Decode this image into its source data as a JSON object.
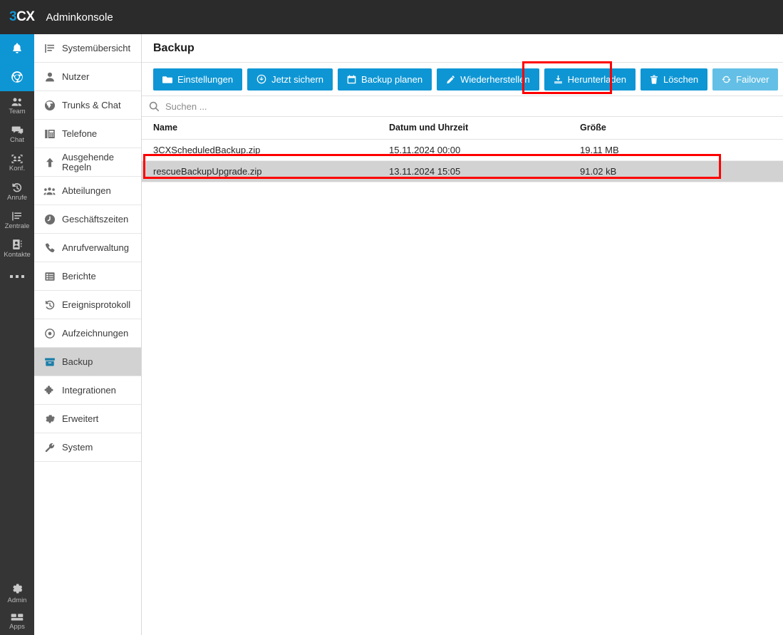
{
  "topbar": {
    "logo_3": "3",
    "logo_cx": "CX",
    "title": "Adminkonsole"
  },
  "rail": {
    "items": [
      {
        "label": "",
        "icon": "bell-icon",
        "state": "blue"
      },
      {
        "label": "",
        "icon": "browser-icon",
        "state": "blue"
      },
      {
        "label": "Team",
        "icon": "team-icon",
        "state": "normal"
      },
      {
        "label": "Chat",
        "icon": "chat-icon",
        "state": "normal"
      },
      {
        "label": "Konf.",
        "icon": "conference-icon",
        "state": "normal"
      },
      {
        "label": "Anrufe",
        "icon": "call-history-icon",
        "state": "normal"
      },
      {
        "label": "Zentrale",
        "icon": "switchboard-icon",
        "state": "normal"
      },
      {
        "label": "Kontakte",
        "icon": "contacts-icon",
        "state": "normal"
      },
      {
        "label": "",
        "icon": "more-dots-icon",
        "state": "normal"
      }
    ],
    "bottom_items": [
      {
        "label": "Admin",
        "icon": "gear-icon"
      },
      {
        "label": "Apps",
        "icon": "apps-grid-icon"
      }
    ]
  },
  "sidebar": {
    "items": [
      {
        "label": "Systemübersicht",
        "icon": "system-overview-icon",
        "active": false
      },
      {
        "label": "Nutzer",
        "icon": "user-icon",
        "active": false
      },
      {
        "label": "Trunks & Chat",
        "icon": "globe-icon",
        "active": false
      },
      {
        "label": "Telefone",
        "icon": "phone-device-icon",
        "active": false
      },
      {
        "label": "Ausgehende Regeln",
        "icon": "up-arrow-icon",
        "active": false
      },
      {
        "label": "Abteilungen",
        "icon": "departments-icon",
        "active": false
      },
      {
        "label": "Geschäftszeiten",
        "icon": "clock-icon",
        "active": false
      },
      {
        "label": "Anrufverwaltung",
        "icon": "handset-icon",
        "active": false
      },
      {
        "label": "Berichte",
        "icon": "reports-icon",
        "active": false
      },
      {
        "label": "Ereignisprotokoll",
        "icon": "event-log-icon",
        "active": false
      },
      {
        "label": "Aufzeichnungen",
        "icon": "record-icon",
        "active": false
      },
      {
        "label": "Backup",
        "icon": "backup-archive-icon",
        "active": true
      },
      {
        "label": "Integrationen",
        "icon": "puzzle-icon",
        "active": false
      },
      {
        "label": "Erweitert",
        "icon": "gear-icon",
        "active": false
      },
      {
        "label": "System",
        "icon": "wrench-icon",
        "active": false
      }
    ]
  },
  "page": {
    "title": "Backup"
  },
  "toolbar": {
    "buttons": [
      {
        "label": "Einstellungen",
        "icon": "folder-icon",
        "disabled": false,
        "highlighted": false
      },
      {
        "label": "Jetzt sichern",
        "icon": "backup-now-icon",
        "disabled": false,
        "highlighted": false
      },
      {
        "label": "Backup planen",
        "icon": "calendar-icon",
        "disabled": false,
        "highlighted": false
      },
      {
        "label": "Wiederherstellen",
        "icon": "pencil-icon",
        "disabled": false,
        "highlighted": false
      },
      {
        "label": "Herunterladen",
        "icon": "download-icon",
        "disabled": false,
        "highlighted": true
      },
      {
        "label": "Löschen",
        "icon": "trash-icon",
        "disabled": false,
        "highlighted": false
      },
      {
        "label": "Failover",
        "icon": "refresh-icon",
        "disabled": true,
        "highlighted": false
      }
    ]
  },
  "search": {
    "placeholder": "Suchen ...",
    "value": "",
    "icon": "search-icon"
  },
  "table": {
    "columns": [
      "Name",
      "Datum und Uhrzeit",
      "Größe"
    ],
    "rows": [
      {
        "name": "3CXScheduledBackup.zip",
        "date": "15.11.2024 00:00",
        "size": "19.11 MB",
        "selected": false,
        "highlighted": false
      },
      {
        "name": "rescueBackupUpgrade.zip",
        "date": "13.11.2024 15:05",
        "size": "91.02 kB",
        "selected": true,
        "highlighted": true
      }
    ]
  },
  "colors": {
    "accent": "#0e96d4",
    "accent_disabled": "#63bfe5",
    "topbar_bg": "#2b2b2b",
    "rail_bg": "#353535",
    "selection_bg": "#d2d2d2",
    "highlight_box": "#ff0000"
  }
}
